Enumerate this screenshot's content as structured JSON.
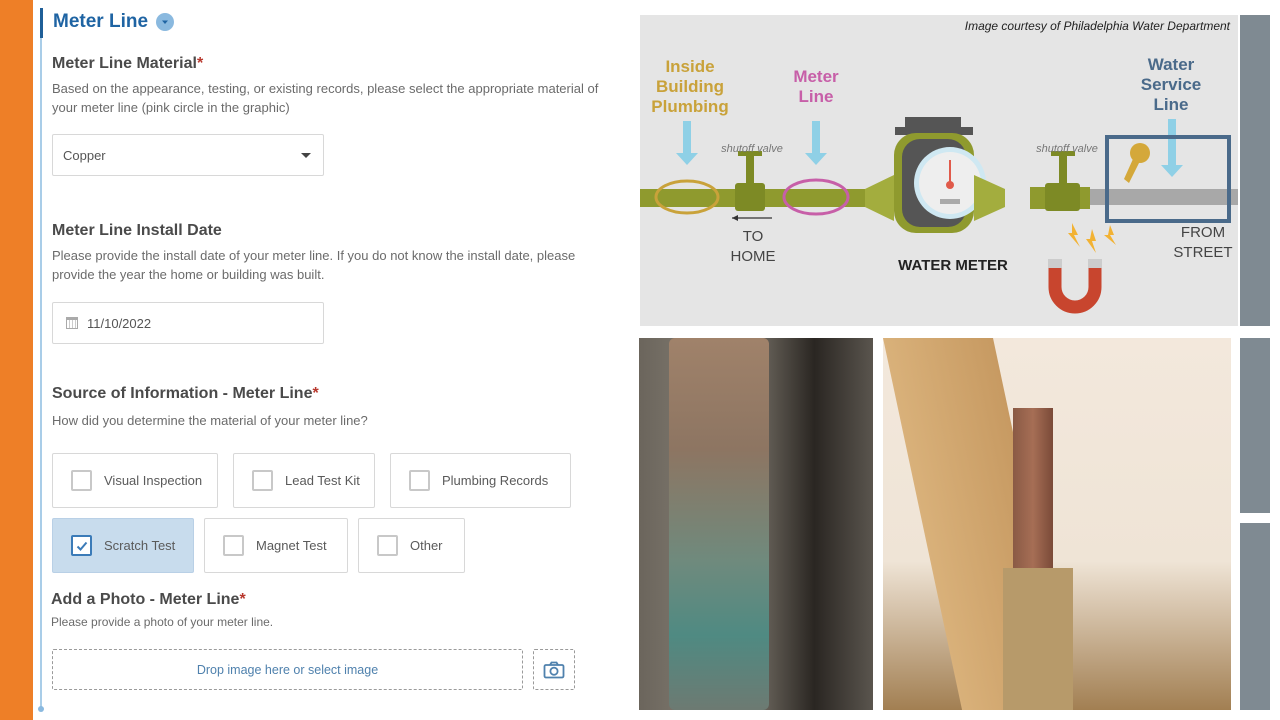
{
  "section": {
    "title": "Meter Line",
    "collapse_icon": "chevron-down-circle-icon"
  },
  "material": {
    "label": "Meter Line Material",
    "required_mark": "*",
    "description": "Based on the appearance, testing, or existing records, please select the appropriate material of your meter line (pink circle in the graphic)",
    "selected": "Copper"
  },
  "install_date": {
    "label": "Meter Line Install Date",
    "description": "Please provide the install date of your meter line. If you do not know the install date, please provide the year the home or building was built.",
    "value": "11/10/2022",
    "icon": "calendar-icon"
  },
  "source": {
    "label": "Source of Information - Meter Line",
    "required_mark": "*",
    "description": "How did you determine the material of your meter line?",
    "options": [
      {
        "label": "Visual Inspection",
        "checked": false
      },
      {
        "label": "Lead Test Kit",
        "checked": false
      },
      {
        "label": "Plumbing Records",
        "checked": false
      },
      {
        "label": "Scratch Test",
        "checked": true
      },
      {
        "label": "Magnet Test",
        "checked": false
      },
      {
        "label": "Other",
        "checked": false
      }
    ]
  },
  "photo": {
    "label": "Add a Photo - Meter Line",
    "required_mark": "*",
    "description": "Please provide a photo of your meter line.",
    "drop_text": "Drop image here or select image",
    "camera_icon": "camera-icon"
  },
  "diagram": {
    "credit": "Image courtesy of Philadelphia Water Department",
    "labels": {
      "inside": [
        "Inside",
        "Building",
        "Plumbing"
      ],
      "meter_line": [
        "Meter",
        "Line"
      ],
      "service_line": [
        "Water",
        "Service",
        "Line"
      ],
      "shutoff_left": "shutoff valve",
      "shutoff_right": "shutoff valve",
      "to_home": [
        "TO",
        "HOME"
      ],
      "from_street": [
        "FROM",
        "STREET"
      ],
      "water_meter": "WATER METER"
    },
    "colors": {
      "inside": "#c9a23a",
      "meter_line": "#c75fa8",
      "service_line": "#4a6a8a",
      "pipe": "#8f9a2e"
    }
  },
  "photos": [
    {
      "name": "corroded-copper-meter-pipe-photo"
    },
    {
      "name": "ceiling-pipe-valve-photo"
    }
  ]
}
